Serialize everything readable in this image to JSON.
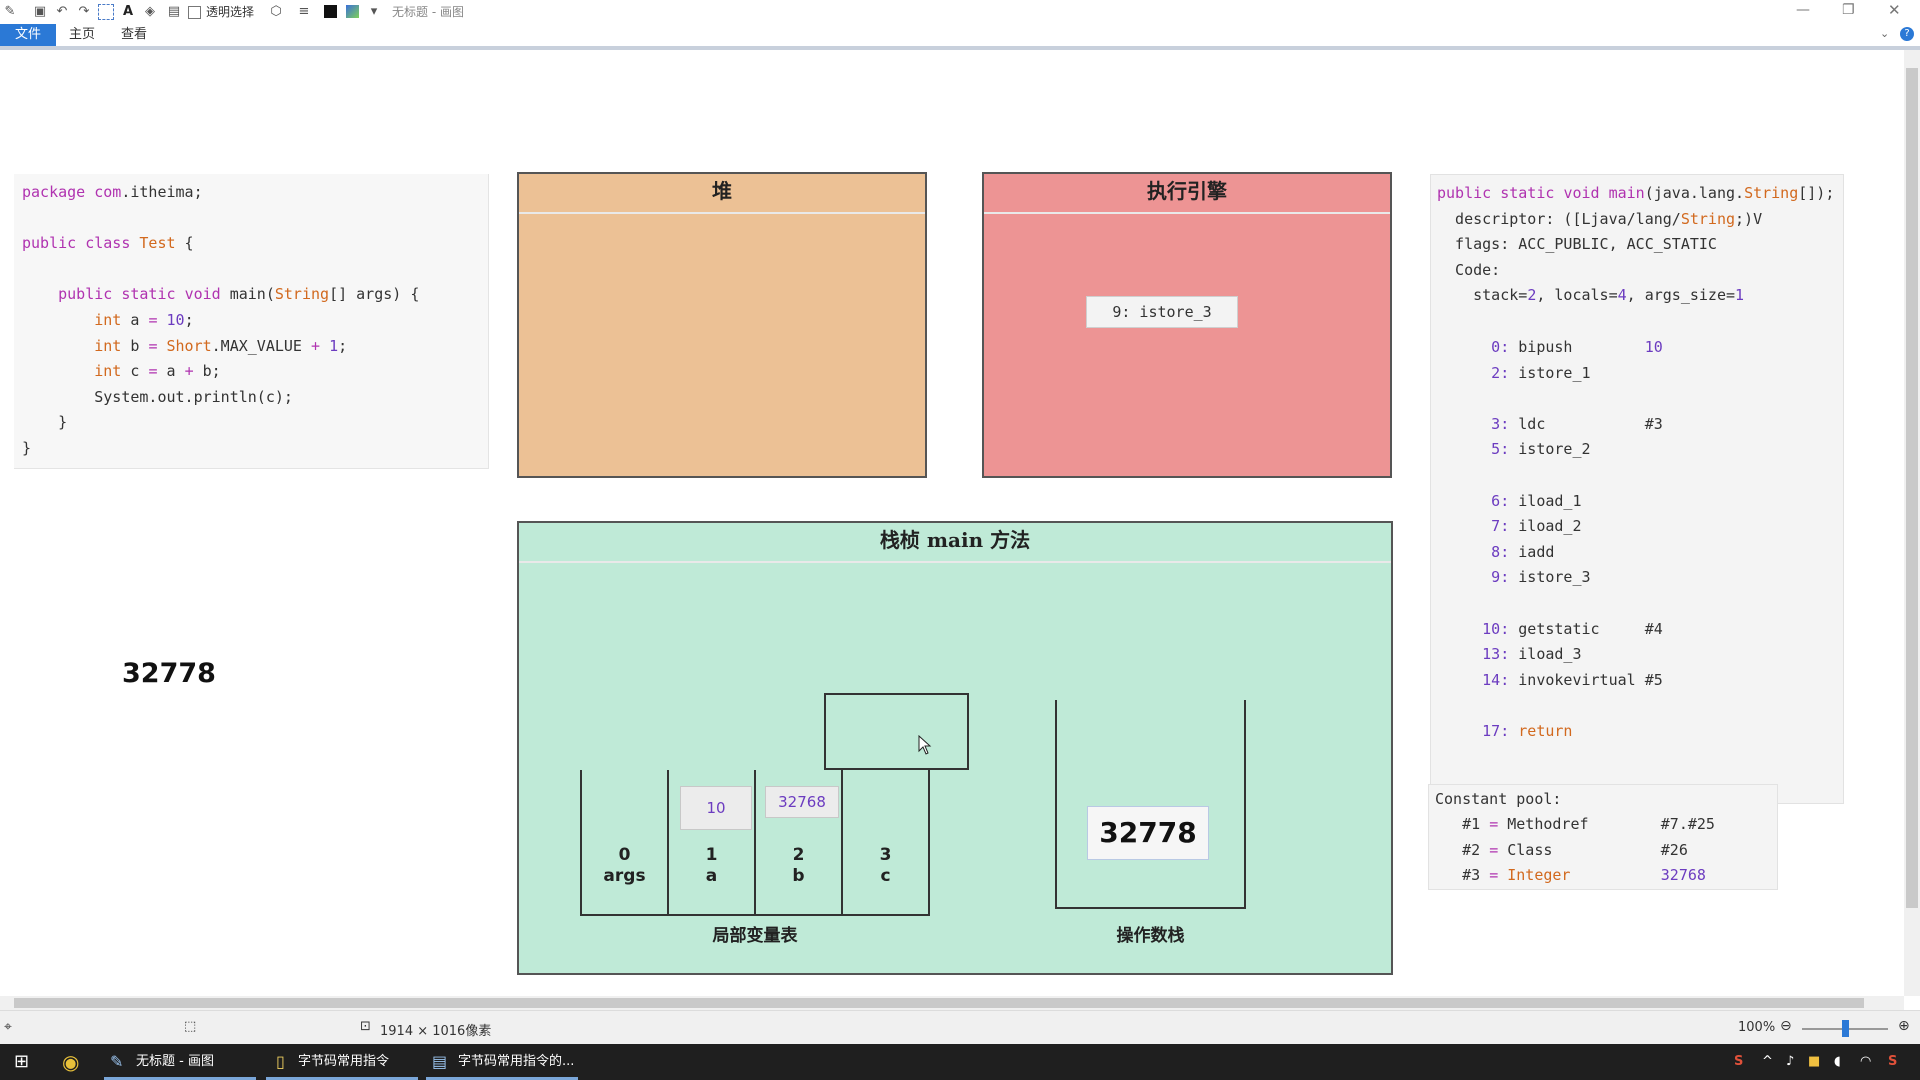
{
  "window": {
    "title": "无标题 - 画图",
    "quick_access_transparent": "透明选择"
  },
  "ribbon": {
    "tabs": [
      {
        "label": "文件"
      },
      {
        "label": "主页"
      },
      {
        "label": "查看"
      }
    ]
  },
  "java_source": {
    "lines": [
      "package com.itheima;",
      "",
      "public class Test {",
      "",
      "    public static void main(String[] args) {",
      "        int a = 10;",
      "        int b = Short.MAX_VALUE + 1;",
      "        int c = a + b;",
      "        System.out.println(c);",
      "    }",
      "}"
    ]
  },
  "heap": {
    "title": "堆"
  },
  "engine": {
    "title": "执行引擎",
    "current_instruction": "9: istore_3"
  },
  "output": {
    "value": "32778"
  },
  "frame": {
    "title": "栈桢 main 方法",
    "locals": [
      {
        "index": "0",
        "name": "args",
        "value": ""
      },
      {
        "index": "1",
        "name": "a",
        "value": "10"
      },
      {
        "index": "2",
        "name": "b",
        "value": "32768"
      },
      {
        "index": "3",
        "name": "c",
        "value": ""
      }
    ],
    "locals_label": "局部变量表",
    "operand_stack_label": "操作数栈",
    "operand_top": "32778"
  },
  "bytecode": {
    "header": [
      "public static void main(java.lang.String[]);",
      "  descriptor: ([Ljava/lang/String;)V",
      "  flags: ACC_PUBLIC, ACC_STATIC",
      "  Code:",
      "    stack=2, locals=4, args_size=1"
    ],
    "instructions": [
      {
        "offset": "0:",
        "op": "bipush",
        "arg": "10"
      },
      {
        "offset": "2:",
        "op": "istore_1",
        "arg": ""
      },
      {
        "offset": "",
        "op": "",
        "arg": ""
      },
      {
        "offset": "3:",
        "op": "ldc",
        "arg": "#3"
      },
      {
        "offset": "5:",
        "op": "istore_2",
        "arg": ""
      },
      {
        "offset": "",
        "op": "",
        "arg": ""
      },
      {
        "offset": "6:",
        "op": "iload_1",
        "arg": ""
      },
      {
        "offset": "7:",
        "op": "iload_2",
        "arg": ""
      },
      {
        "offset": "8:",
        "op": "iadd",
        "arg": ""
      },
      {
        "offset": "9:",
        "op": "istore_3",
        "arg": ""
      },
      {
        "offset": "",
        "op": "",
        "arg": ""
      },
      {
        "offset": "10:",
        "op": "getstatic",
        "arg": "#4"
      },
      {
        "offset": "13:",
        "op": "iload_3",
        "arg": ""
      },
      {
        "offset": "14:",
        "op": "invokevirtual",
        "arg": "#5"
      },
      {
        "offset": "",
        "op": "",
        "arg": ""
      },
      {
        "offset": "17:",
        "op": "return",
        "arg": ""
      }
    ]
  },
  "constant_pool": {
    "title": "Constant pool:",
    "entries": [
      {
        "id": "#1",
        "kind": "Methodref",
        "ref": "#7.#25"
      },
      {
        "id": "#2",
        "kind": "Class",
        "ref": "#26"
      },
      {
        "id": "#3",
        "kind": "Integer",
        "ref": "32768"
      }
    ]
  },
  "status": {
    "dimensions": "1914 × 1016像素",
    "zoom": "100%"
  },
  "taskbar": {
    "items": [
      {
        "label": "无标题 - 画图"
      },
      {
        "label": "字节码常用指令"
      },
      {
        "label": "字节码常用指令的..."
      }
    ]
  },
  "colors": {
    "heap_fill": "#ecc195",
    "engine_fill": "#ed9494",
    "frame_fill": "#bfead7",
    "file_tab": "#2b79d6"
  }
}
